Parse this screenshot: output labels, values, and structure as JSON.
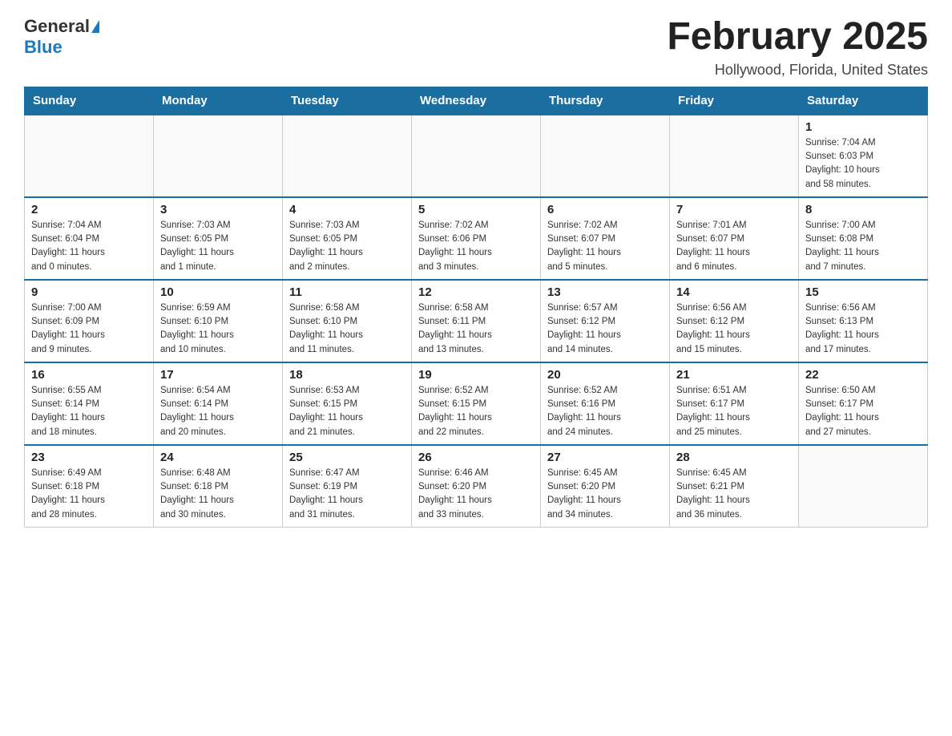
{
  "header": {
    "logo_general": "General",
    "logo_blue": "Blue",
    "title": "February 2025",
    "subtitle": "Hollywood, Florida, United States"
  },
  "days_of_week": [
    "Sunday",
    "Monday",
    "Tuesday",
    "Wednesday",
    "Thursday",
    "Friday",
    "Saturday"
  ],
  "weeks": [
    [
      {
        "day": "",
        "info": ""
      },
      {
        "day": "",
        "info": ""
      },
      {
        "day": "",
        "info": ""
      },
      {
        "day": "",
        "info": ""
      },
      {
        "day": "",
        "info": ""
      },
      {
        "day": "",
        "info": ""
      },
      {
        "day": "1",
        "info": "Sunrise: 7:04 AM\nSunset: 6:03 PM\nDaylight: 10 hours\nand 58 minutes."
      }
    ],
    [
      {
        "day": "2",
        "info": "Sunrise: 7:04 AM\nSunset: 6:04 PM\nDaylight: 11 hours\nand 0 minutes."
      },
      {
        "day": "3",
        "info": "Sunrise: 7:03 AM\nSunset: 6:05 PM\nDaylight: 11 hours\nand 1 minute."
      },
      {
        "day": "4",
        "info": "Sunrise: 7:03 AM\nSunset: 6:05 PM\nDaylight: 11 hours\nand 2 minutes."
      },
      {
        "day": "5",
        "info": "Sunrise: 7:02 AM\nSunset: 6:06 PM\nDaylight: 11 hours\nand 3 minutes."
      },
      {
        "day": "6",
        "info": "Sunrise: 7:02 AM\nSunset: 6:07 PM\nDaylight: 11 hours\nand 5 minutes."
      },
      {
        "day": "7",
        "info": "Sunrise: 7:01 AM\nSunset: 6:07 PM\nDaylight: 11 hours\nand 6 minutes."
      },
      {
        "day": "8",
        "info": "Sunrise: 7:00 AM\nSunset: 6:08 PM\nDaylight: 11 hours\nand 7 minutes."
      }
    ],
    [
      {
        "day": "9",
        "info": "Sunrise: 7:00 AM\nSunset: 6:09 PM\nDaylight: 11 hours\nand 9 minutes."
      },
      {
        "day": "10",
        "info": "Sunrise: 6:59 AM\nSunset: 6:10 PM\nDaylight: 11 hours\nand 10 minutes."
      },
      {
        "day": "11",
        "info": "Sunrise: 6:58 AM\nSunset: 6:10 PM\nDaylight: 11 hours\nand 11 minutes."
      },
      {
        "day": "12",
        "info": "Sunrise: 6:58 AM\nSunset: 6:11 PM\nDaylight: 11 hours\nand 13 minutes."
      },
      {
        "day": "13",
        "info": "Sunrise: 6:57 AM\nSunset: 6:12 PM\nDaylight: 11 hours\nand 14 minutes."
      },
      {
        "day": "14",
        "info": "Sunrise: 6:56 AM\nSunset: 6:12 PM\nDaylight: 11 hours\nand 15 minutes."
      },
      {
        "day": "15",
        "info": "Sunrise: 6:56 AM\nSunset: 6:13 PM\nDaylight: 11 hours\nand 17 minutes."
      }
    ],
    [
      {
        "day": "16",
        "info": "Sunrise: 6:55 AM\nSunset: 6:14 PM\nDaylight: 11 hours\nand 18 minutes."
      },
      {
        "day": "17",
        "info": "Sunrise: 6:54 AM\nSunset: 6:14 PM\nDaylight: 11 hours\nand 20 minutes."
      },
      {
        "day": "18",
        "info": "Sunrise: 6:53 AM\nSunset: 6:15 PM\nDaylight: 11 hours\nand 21 minutes."
      },
      {
        "day": "19",
        "info": "Sunrise: 6:52 AM\nSunset: 6:15 PM\nDaylight: 11 hours\nand 22 minutes."
      },
      {
        "day": "20",
        "info": "Sunrise: 6:52 AM\nSunset: 6:16 PM\nDaylight: 11 hours\nand 24 minutes."
      },
      {
        "day": "21",
        "info": "Sunrise: 6:51 AM\nSunset: 6:17 PM\nDaylight: 11 hours\nand 25 minutes."
      },
      {
        "day": "22",
        "info": "Sunrise: 6:50 AM\nSunset: 6:17 PM\nDaylight: 11 hours\nand 27 minutes."
      }
    ],
    [
      {
        "day": "23",
        "info": "Sunrise: 6:49 AM\nSunset: 6:18 PM\nDaylight: 11 hours\nand 28 minutes."
      },
      {
        "day": "24",
        "info": "Sunrise: 6:48 AM\nSunset: 6:18 PM\nDaylight: 11 hours\nand 30 minutes."
      },
      {
        "day": "25",
        "info": "Sunrise: 6:47 AM\nSunset: 6:19 PM\nDaylight: 11 hours\nand 31 minutes."
      },
      {
        "day": "26",
        "info": "Sunrise: 6:46 AM\nSunset: 6:20 PM\nDaylight: 11 hours\nand 33 minutes."
      },
      {
        "day": "27",
        "info": "Sunrise: 6:45 AM\nSunset: 6:20 PM\nDaylight: 11 hours\nand 34 minutes."
      },
      {
        "day": "28",
        "info": "Sunrise: 6:45 AM\nSunset: 6:21 PM\nDaylight: 11 hours\nand 36 minutes."
      },
      {
        "day": "",
        "info": ""
      }
    ]
  ]
}
